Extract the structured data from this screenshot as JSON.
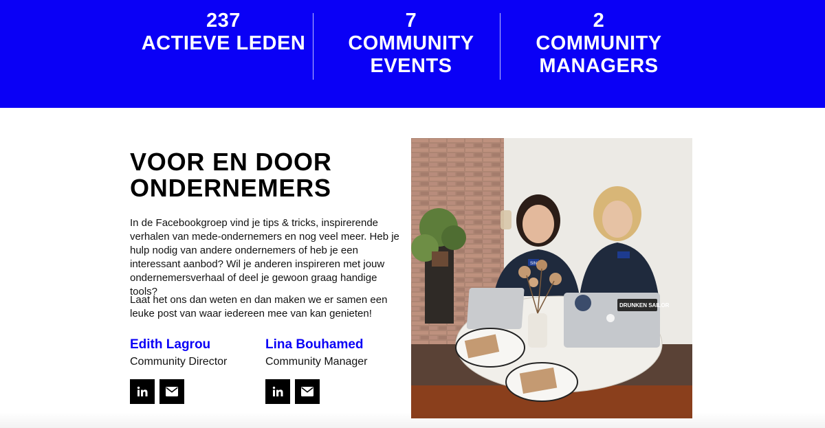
{
  "stats": [
    {
      "number": "237",
      "label": "ACTIEVE LEDEN"
    },
    {
      "number": "7",
      "label": "COMMUNITY EVENTS"
    },
    {
      "number": "2",
      "label": "COMMUNITY MANAGERS"
    }
  ],
  "section": {
    "title": "VOOR EN DOOR ONDERNEMERS",
    "paragraphs": [
      "In de Facebookgroep vind je tips & tricks, inspirerende verhalen van mede-ondernemers en nog veel meer. Heb je hulp nodig van andere ondernemers of heb je een interessant aanbod? Wil je anderen inspireren met jouw ondernemersverhaal of deel je gewoon graag handige tools?",
      "Laat het ons dan weten en dan maken we er samen een leuke post van waar iedereen mee van kan genieten!"
    ]
  },
  "people": [
    {
      "name": "Edith Lagrou",
      "role": "Community Director"
    },
    {
      "name": "Lina Bouhamed",
      "role": "Community Manager"
    }
  ],
  "photo": {
    "sticker_text": "DRUNKEN SAILOR",
    "badge_text": "SINC"
  },
  "colors": {
    "brand_blue": "#0a00f6",
    "icon_bg": "#000000",
    "text": "#111111"
  },
  "icons": [
    "linkedin-icon",
    "envelope-icon"
  ]
}
